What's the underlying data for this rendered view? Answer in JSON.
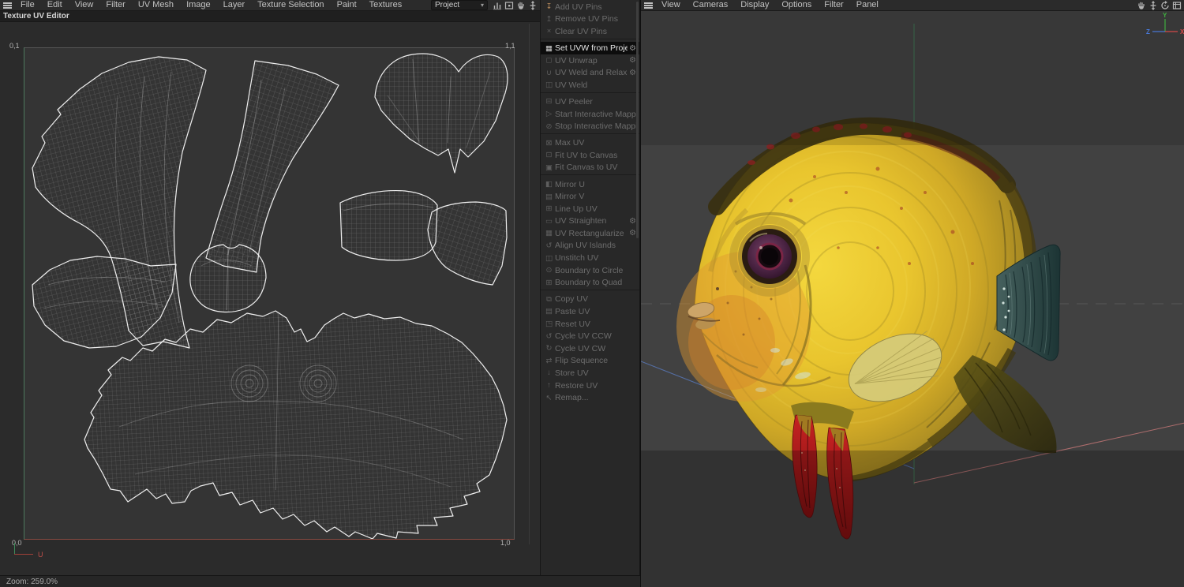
{
  "colors": {
    "highlight_row_bg": "#0d0d0d",
    "pin_icon": "#b5885a",
    "axis_x": "#d84848",
    "axis_y": "#58c858",
    "axis_z": "#4878d8",
    "uv_u_axis": "#c0504a",
    "uv_v_axis": "#3f8a5a",
    "viewport_bg": "#414141",
    "fish_body": "#e9c52e",
    "tail": "#2c4444",
    "pelvic_fin": "#c62222"
  },
  "left_panel": {
    "menu": [
      "File",
      "Edit",
      "View",
      "Filter",
      "UV Mesh",
      "Image",
      "Layer",
      "Texture Selection",
      "Paint",
      "Textures"
    ],
    "project_select": {
      "value": "Project"
    },
    "toolbar_icons": [
      "histogram-icon",
      "frame-icon",
      "hand-icon",
      "pan-vertical-icon"
    ],
    "tab_title": "Texture UV Editor",
    "canvas": {
      "label_top_left": "0,1",
      "label_top_right": "1,1",
      "label_bottom_left": "0,0",
      "label_bottom_right": "1,0",
      "u_axis_label": "U"
    },
    "status_bar": {
      "zoom": "Zoom: 259.0%"
    }
  },
  "uv_commands": {
    "gear_glyph": "⚙",
    "groups": [
      {
        "items": [
          {
            "label": "Add UV Pins",
            "icon": "pin-add-icon",
            "glyph": "↧",
            "disabled": true,
            "icon_color": "#b5885a"
          },
          {
            "label": "Remove UV Pins",
            "icon": "pin-remove-icon",
            "glyph": "↥",
            "disabled": true
          },
          {
            "label": "Clear UV Pins",
            "icon": "clear-x-icon",
            "glyph": "×",
            "disabled": true
          }
        ]
      },
      {
        "items": [
          {
            "label": "Set UVW from Projection",
            "icon": "projection-grid-icon",
            "glyph": "▦",
            "disabled": false,
            "highlighted": true,
            "gear": true
          },
          {
            "label": "UV Unwrap",
            "icon": "unwrap-icon",
            "glyph": "◻",
            "disabled": true,
            "gear": true
          },
          {
            "label": "UV Weld and Relax",
            "icon": "weld-relax-icon",
            "glyph": "∪",
            "disabled": true,
            "gear": true
          },
          {
            "label": "UV Weld",
            "icon": "weld-icon",
            "glyph": "◫",
            "disabled": true
          }
        ]
      },
      {
        "items": [
          {
            "label": "UV Peeler",
            "icon": "peeler-icon",
            "glyph": "⊟",
            "disabled": true
          },
          {
            "label": "Start Interactive Mapping",
            "icon": "play-icon",
            "glyph": "▷",
            "disabled": true
          },
          {
            "label": "Stop Interactive Mapping",
            "icon": "stop-icon",
            "glyph": "⊘",
            "disabled": true
          }
        ]
      },
      {
        "items": [
          {
            "label": "Max UV",
            "icon": "max-uv-icon",
            "glyph": "⊠",
            "disabled": true
          },
          {
            "label": "Fit UV to Canvas",
            "icon": "fit-uv-canvas-icon",
            "glyph": "⊡",
            "disabled": true
          },
          {
            "label": "Fit Canvas to UV",
            "icon": "fit-canvas-uv-icon",
            "glyph": "▣",
            "disabled": true
          }
        ]
      },
      {
        "items": [
          {
            "label": "Mirror U",
            "icon": "mirror-u-icon",
            "glyph": "◧",
            "disabled": true
          },
          {
            "label": "Mirror V",
            "icon": "mirror-v-icon",
            "glyph": "▤",
            "disabled": true
          },
          {
            "label": "Line Up UV",
            "icon": "line-up-icon",
            "glyph": "⊞",
            "disabled": true
          },
          {
            "label": "UV Straighten",
            "icon": "straighten-icon",
            "glyph": "▭",
            "disabled": true,
            "gear": true
          },
          {
            "label": "UV Rectangularize",
            "icon": "rectangularize-icon",
            "glyph": "▦",
            "disabled": true,
            "gear": true
          },
          {
            "label": "Align UV Islands",
            "icon": "align-islands-icon",
            "glyph": "↺",
            "disabled": true
          },
          {
            "label": "Unstitch UV",
            "icon": "unstitch-icon",
            "glyph": "◫",
            "disabled": true
          },
          {
            "label": "Boundary to Circle",
            "icon": "boundary-circle-icon",
            "glyph": "⊙",
            "disabled": true
          },
          {
            "label": "Boundary to Quad",
            "icon": "boundary-quad-icon",
            "glyph": "⊞",
            "disabled": true
          }
        ]
      },
      {
        "items": [
          {
            "label": "Copy UV",
            "icon": "copy-icon",
            "glyph": "⧉",
            "disabled": true
          },
          {
            "label": "Paste UV",
            "icon": "paste-icon",
            "glyph": "▤",
            "disabled": true
          },
          {
            "label": "Reset UV",
            "icon": "reset-icon",
            "glyph": "◳",
            "disabled": true
          },
          {
            "label": "Cycle UV CCW",
            "icon": "cycle-ccw-icon",
            "glyph": "↺",
            "disabled": true
          },
          {
            "label": "Cycle UV CW",
            "icon": "cycle-cw-icon",
            "glyph": "↻",
            "disabled": true
          },
          {
            "label": "Flip Sequence",
            "icon": "flip-sequence-icon",
            "glyph": "⇄",
            "disabled": true
          },
          {
            "label": "Store UV",
            "icon": "store-icon",
            "glyph": "↓",
            "disabled": true
          },
          {
            "label": "Restore UV",
            "icon": "restore-icon",
            "glyph": "↑",
            "disabled": true
          },
          {
            "label": "Remap...",
            "icon": "remap-icon",
            "glyph": "↖",
            "disabled": true
          }
        ]
      }
    ]
  },
  "viewport": {
    "menu": [
      "View",
      "Cameras",
      "Display",
      "Options",
      "Filter",
      "Panel"
    ],
    "toolbar_icons": [
      "hand-icon",
      "pan-vertical-icon",
      "rotate-icon",
      "panel-icon"
    ],
    "gizmo": {
      "x": "X",
      "y": "Y",
      "z": "Z"
    }
  }
}
